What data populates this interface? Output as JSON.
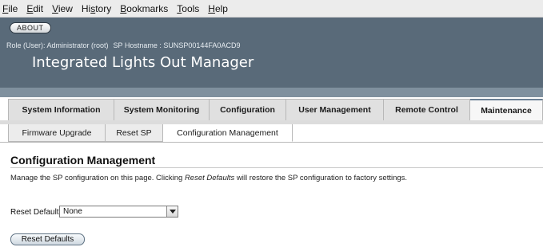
{
  "browser_menu": [
    {
      "key": "F",
      "rest": "ile"
    },
    {
      "key": "E",
      "rest": "dit"
    },
    {
      "key": "V",
      "rest": "iew"
    },
    {
      "pre": "Hi",
      "key": "s",
      "rest": "tory"
    },
    {
      "key": "B",
      "rest": "ookmarks"
    },
    {
      "key": "T",
      "rest": "ools"
    },
    {
      "key": "H",
      "rest": "elp"
    }
  ],
  "header": {
    "about_label": "ABOUT",
    "role_text": "Role (User): Administrator (root)",
    "hostname_text": "SP Hostname : SUNSP00144FA0ACD9",
    "product_title": "Integrated Lights Out Manager"
  },
  "primary_tabs": [
    {
      "label": "System Information",
      "selected": false
    },
    {
      "label": "System Monitoring",
      "selected": false
    },
    {
      "label": "Configuration",
      "selected": false
    },
    {
      "label": "User Management",
      "selected": false
    },
    {
      "label": "Remote Control",
      "selected": false
    },
    {
      "label": "Maintenance",
      "selected": true
    }
  ],
  "secondary_tabs": [
    {
      "label": "Firmware Upgrade",
      "selected": false
    },
    {
      "label": "Reset SP",
      "selected": false
    },
    {
      "label": "Configuration Management",
      "selected": true
    }
  ],
  "page": {
    "title": "Configuration Management",
    "help_before": "Manage the SP configuration on this page. Clicking ",
    "help_emphasis": "Reset Defaults",
    "help_after": " will restore the SP configuration to factory settings.",
    "reset_defaults_label": "Reset Defaults:",
    "reset_defaults_value": "None",
    "reset_button": "Reset Defaults"
  }
}
